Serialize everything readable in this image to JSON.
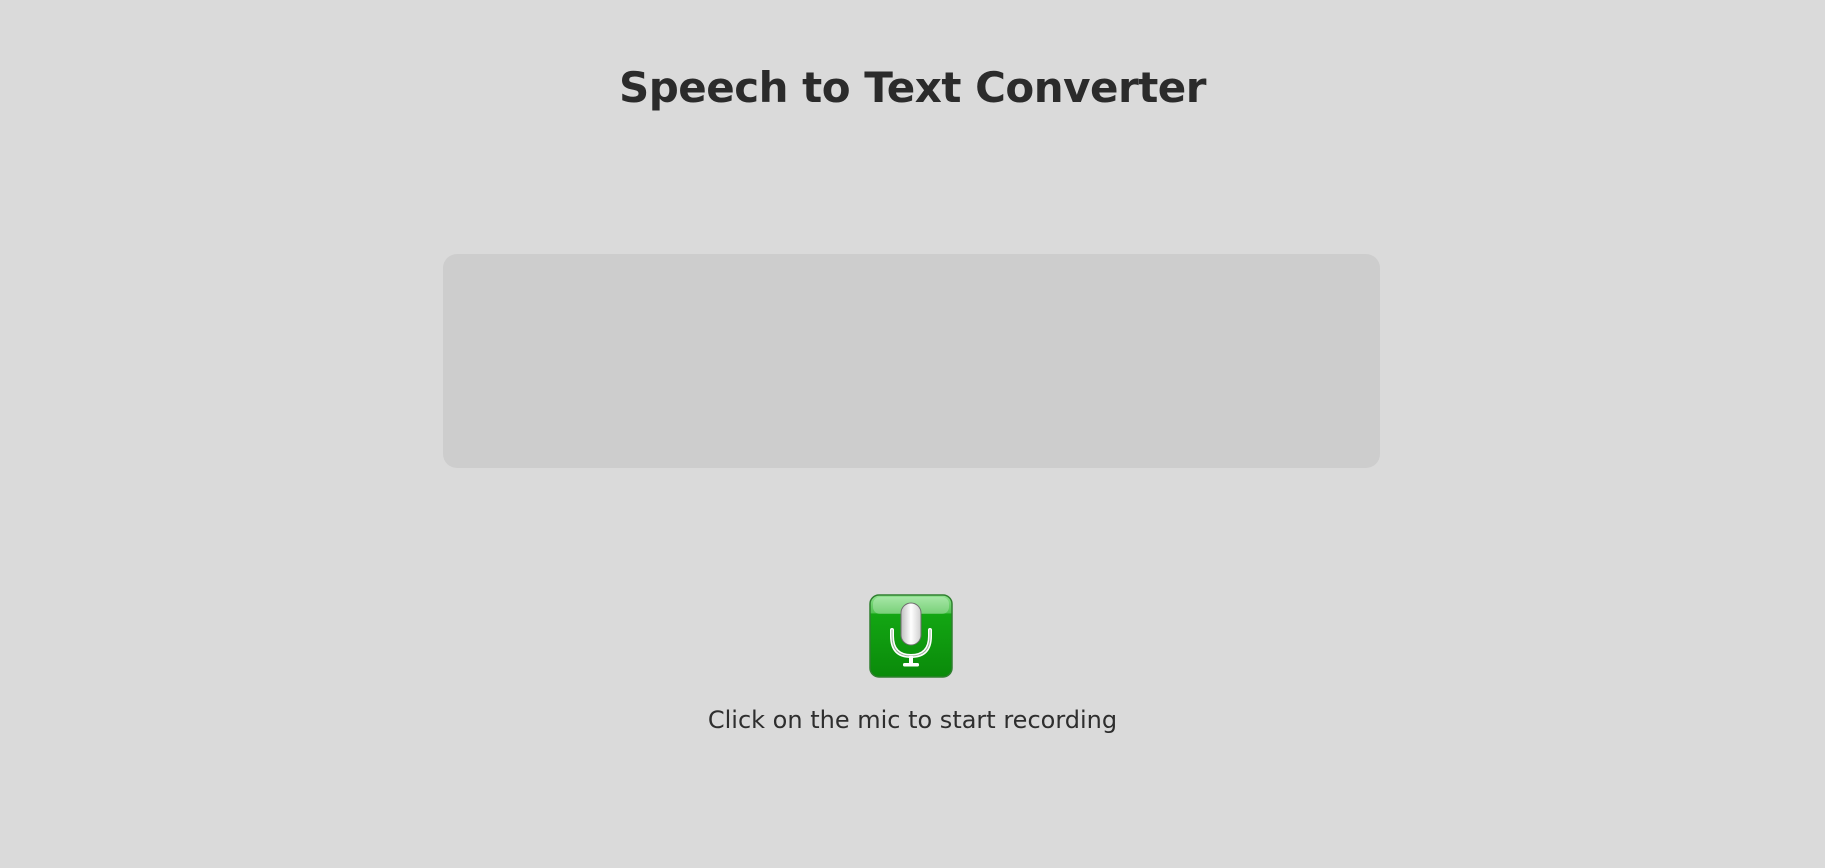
{
  "header": {
    "title": "Speech to Text Converter"
  },
  "transcript": {
    "text": ""
  },
  "mic": {
    "icon": "microphone-icon",
    "accent_color": "#19a619"
  },
  "instruction": {
    "text": "Click on the mic to start recording"
  }
}
